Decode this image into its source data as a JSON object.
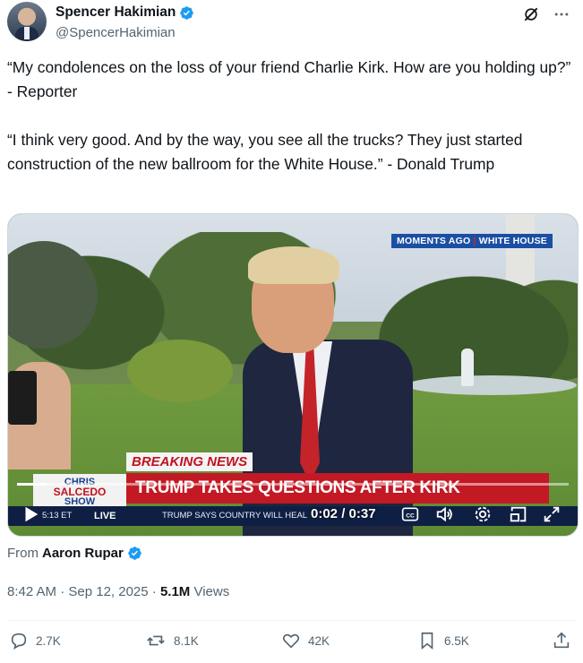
{
  "author": {
    "name": "Spencer Hakimian",
    "handle": "@SpencerHakimian"
  },
  "header_icons": [
    "grok-slash-icon",
    "more-icon"
  ],
  "tweet": {
    "text": "“My condolences on the loss of your friend Charlie Kirk. How are you holding up?” - Reporter\n\n“I think very good. And by the way, you see all the trucks? They just started construction of the new ballroom for the White House.” - Donald Trump"
  },
  "video": {
    "moments_left": "MOMENTS AGO",
    "moments_sep": "|",
    "moments_right": "WHITE HOUSE",
    "breaking": "BREAKING NEWS",
    "headline": "TRUMP TAKES QUESTIONS AFTER KIRK ASSASSINATION",
    "logo_top": "CHRIS",
    "logo_mid": "SALCEDO",
    "logo_bottom": "SHOW",
    "ticker_time": "5:13 ET",
    "ticker_live": "LIVE",
    "ticker_text": "TRUMP SAYS COUNTRY WILL HEAL",
    "time_display": "0:02 / 0:37",
    "progress": 0.054,
    "colors": {
      "banner": "#c31925",
      "ticker": "#0f1f44"
    }
  },
  "from": {
    "label": "From",
    "name": "Aaron Rupar"
  },
  "meta": {
    "time": "8:42 AM · Sep 12, 2025 · ",
    "views_count": "5.1M",
    "views_label": " Views"
  },
  "actions": {
    "replies": "2.7K",
    "reposts": "8.1K",
    "likes": "42K",
    "bookmarks": "6.5K"
  },
  "accent": "#1d9bf0"
}
